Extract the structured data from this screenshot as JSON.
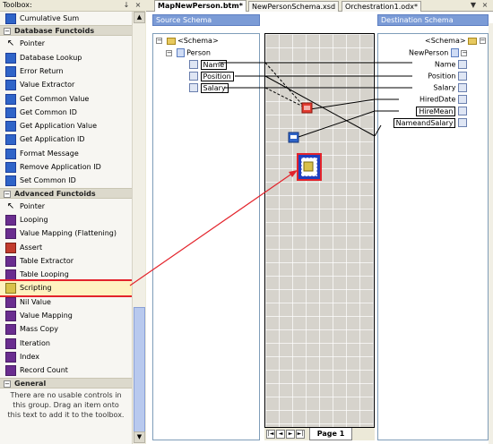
{
  "toolbox": {
    "title": "Toolbox:",
    "pin": "↓",
    "close": "×",
    "items": [
      {
        "label": "Cumulative Sum",
        "icon": "cumulative-sum-icon",
        "kind": "fn"
      },
      {
        "section": "Database Functoids",
        "expanded": true
      },
      {
        "label": "Pointer",
        "icon": "pointer-icon",
        "kind": "ptr"
      },
      {
        "label": "Database Lookup",
        "icon": "database-lookup-icon",
        "kind": "fn"
      },
      {
        "label": "Error Return",
        "icon": "error-return-icon",
        "kind": "fn"
      },
      {
        "label": "Value Extractor",
        "icon": "value-extractor-icon",
        "kind": "fn"
      },
      {
        "label": "Get Common Value",
        "icon": "get-common-value-icon",
        "kind": "fn"
      },
      {
        "label": "Get Common ID",
        "icon": "get-common-id-icon",
        "kind": "fn"
      },
      {
        "label": "Get Application Value",
        "icon": "get-application-value-icon",
        "kind": "fn"
      },
      {
        "label": "Get Application ID",
        "icon": "get-application-id-icon",
        "kind": "fn"
      },
      {
        "label": "Format Message",
        "icon": "format-message-icon",
        "kind": "fn"
      },
      {
        "label": "Remove Application ID",
        "icon": "remove-application-id-icon",
        "kind": "fn"
      },
      {
        "label": "Set Common ID",
        "icon": "set-common-id-icon",
        "kind": "fn"
      },
      {
        "section": "Advanced Functoids",
        "expanded": true
      },
      {
        "label": "Pointer",
        "icon": "pointer-icon",
        "kind": "ptr"
      },
      {
        "label": "Looping",
        "icon": "looping-icon",
        "kind": "purple"
      },
      {
        "label": "Value Mapping (Flattening)",
        "icon": "value-mapping-flattening-icon",
        "kind": "purple"
      },
      {
        "label": "Assert",
        "icon": "assert-icon",
        "kind": "red"
      },
      {
        "label": "Table Extractor",
        "icon": "table-extractor-icon",
        "kind": "purple"
      },
      {
        "label": "Table Looping",
        "icon": "table-looping-icon",
        "kind": "purple"
      },
      {
        "label": "Scripting",
        "icon": "scripting-icon",
        "kind": "yellow",
        "selected": true
      },
      {
        "label": "Nil Value",
        "icon": "nil-value-icon",
        "kind": "purple"
      },
      {
        "label": "Value Mapping",
        "icon": "value-mapping-icon",
        "kind": "purple"
      },
      {
        "label": "Mass Copy",
        "icon": "mass-copy-icon",
        "kind": "purple"
      },
      {
        "label": "Iteration",
        "icon": "iteration-icon",
        "kind": "purple"
      },
      {
        "label": "Index",
        "icon": "index-icon",
        "kind": "purple"
      },
      {
        "label": "Record Count",
        "icon": "record-count-icon",
        "kind": "purple"
      },
      {
        "section": "General",
        "expanded": true
      }
    ],
    "general_text": "There are no usable controls in this group. Drag an item onto this text to add it to the toolbox."
  },
  "tabs": [
    {
      "label": "MapNewPerson.btm*",
      "active": true
    },
    {
      "label": "NewPersonSchema.xsd",
      "active": false
    },
    {
      "label": "Orchestration1.odx*",
      "active": false
    }
  ],
  "tab_controls": {
    "dropdown": "▼",
    "close": "×"
  },
  "source": {
    "title": "Source Schema",
    "root": "<Schema>",
    "record": "Person",
    "fields": [
      "Name",
      "Position",
      "Salary"
    ]
  },
  "destination": {
    "title": "Destination Schema",
    "root": "<Schema>",
    "record": "NewPerson",
    "fields": [
      "Name",
      "Position",
      "Salary",
      "HiredDate",
      "HireMean",
      "NameandSalary"
    ]
  },
  "grid": {
    "page_tab": "Page 1",
    "nav": [
      "|◄",
      "◄",
      "►",
      "►|"
    ]
  },
  "colors": {
    "highlight": "#e3232b",
    "pane_title": "#7b9bd6",
    "grid_bg": "#d6d3cc"
  }
}
